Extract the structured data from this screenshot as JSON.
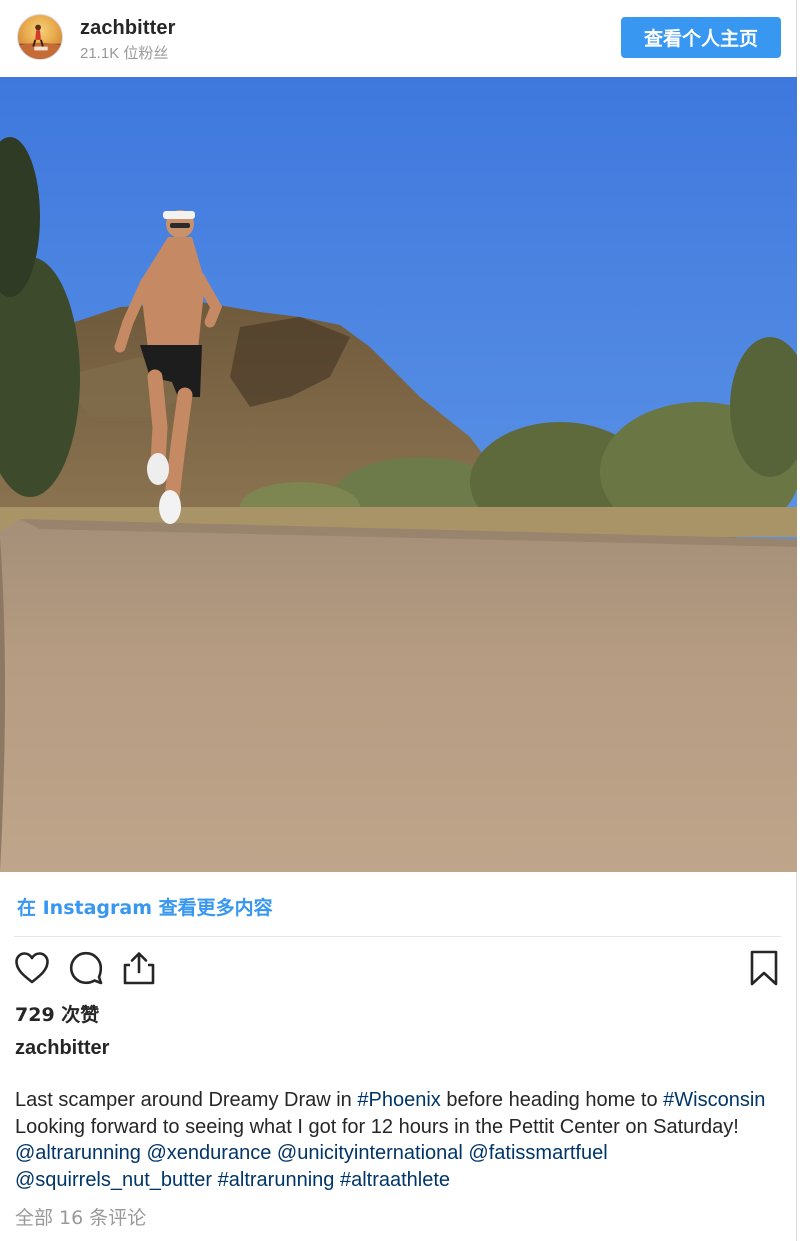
{
  "header": {
    "username": "zachbitter",
    "followers": "21.1K 位粉丝",
    "profile_button": "查看个人主页"
  },
  "view_more": "在 Instagram 查看更多内容",
  "actions": {
    "like_icon": "heart-icon",
    "comment_icon": "comment-bubble-icon",
    "share_icon": "share-upload-icon",
    "save_icon": "bookmark-icon"
  },
  "likes": "729 次赞",
  "caption": {
    "username": "zachbitter",
    "segments": [
      {
        "text": "Last scamper around Dreamy Draw in ",
        "link": false
      },
      {
        "text": "#Phoenix",
        "link": true
      },
      {
        "text": " before heading home to ",
        "link": false
      },
      {
        "text": "#Wisconsin",
        "link": true
      },
      {
        "text": " Looking forward to seeing what I got for 12 hours in the Pettit Center on Saturday! ",
        "link": false
      },
      {
        "text": "@altrarunning",
        "link": true
      },
      {
        "text": " ",
        "link": false
      },
      {
        "text": "@xendurance",
        "link": true
      },
      {
        "text": " ",
        "link": false
      },
      {
        "text": "@unicityinternational",
        "link": true
      },
      {
        "text": " ",
        "link": false
      },
      {
        "text": "@fatissmartfuel",
        "link": true
      },
      {
        "text": " ",
        "link": false
      },
      {
        "text": "@squirrels_nut_butter",
        "link": true
      },
      {
        "text": " ",
        "link": false
      },
      {
        "text": "#altrarunning",
        "link": true
      },
      {
        "text": " ",
        "link": false
      },
      {
        "text": "#altraathlete",
        "link": true
      }
    ]
  },
  "comments": "全部 16 条评论",
  "colors": {
    "accent": "#3897f0",
    "link": "#003569",
    "muted": "#999999",
    "text": "#262626"
  }
}
